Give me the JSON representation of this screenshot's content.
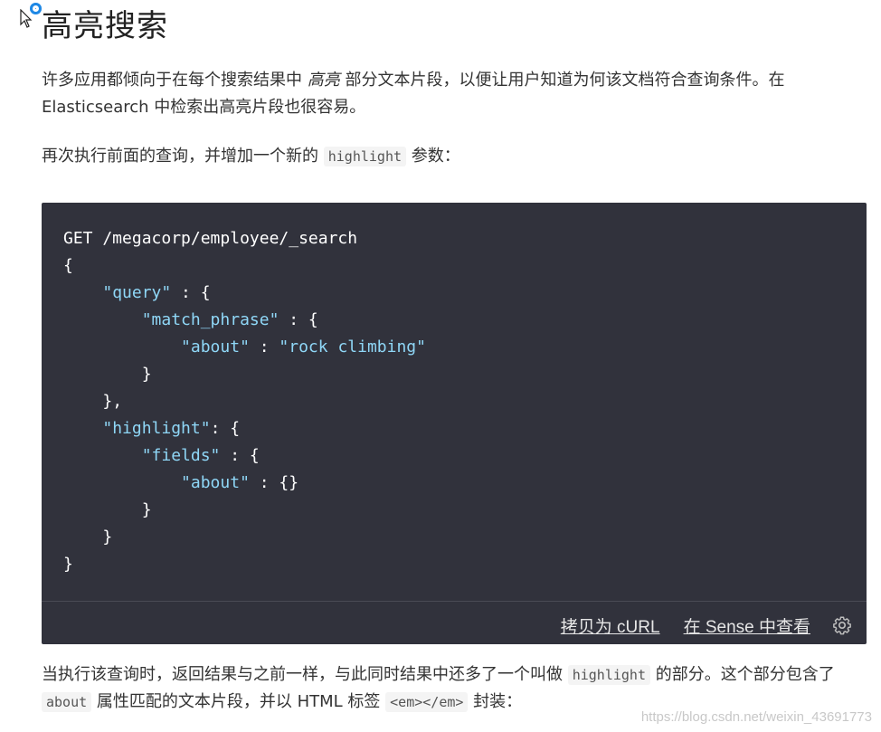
{
  "heading": "高亮搜索",
  "p1": {
    "before": "许多应用都倾向于在每个搜索结果中 ",
    "emph": "高亮",
    "after": " 部分文本片段，以便让用户知道为何该文档符合查询条件。在 Elasticsearch 中检索出高亮片段也很容易。"
  },
  "p2": {
    "before": "再次执行前面的查询，并增加一个新的 ",
    "code": "highlight",
    "after": " 参数："
  },
  "code_block": {
    "request_line": "GET /megacorp/employee/_search",
    "lines": [
      {
        "indent": "",
        "text": "{"
      },
      {
        "indent": "    ",
        "key": "\"query\"",
        "rest": " : {"
      },
      {
        "indent": "        ",
        "key": "\"match_phrase\"",
        "rest": " : {"
      },
      {
        "indent": "            ",
        "key": "\"about\"",
        "rest": " : ",
        "val": "\"rock climbing\""
      },
      {
        "indent": "        ",
        "text": "}"
      },
      {
        "indent": "    ",
        "text": "},"
      },
      {
        "indent": "    ",
        "key": "\"highlight\"",
        "rest": ": {"
      },
      {
        "indent": "        ",
        "key": "\"fields\"",
        "rest": " : {"
      },
      {
        "indent": "            ",
        "key": "\"about\"",
        "rest": " : {}"
      },
      {
        "indent": "        ",
        "text": "}"
      },
      {
        "indent": "    ",
        "text": "}"
      },
      {
        "indent": "",
        "text": "}"
      }
    ],
    "copy_curl_label": "拷贝为 cURL",
    "view_sense_label": "在 Sense 中查看",
    "settings_icon": "gear-icon"
  },
  "p3": {
    "a": "当执行该查询时，返回结果与之前一样，与此同时结果中还多了一个叫做 ",
    "code1": "highlight",
    "b": " 的部分。这个部分包含了 ",
    "code2": "about",
    "c": " 属性匹配的文本片段，并以 HTML 标签 ",
    "code3": "<em></em>",
    "d": " 封装："
  },
  "watermark": "https://blog.csdn.net/weixin_43691773",
  "colors": {
    "code_bg": "#31323c",
    "code_string": "#8fd7f7",
    "text": "#333333"
  }
}
